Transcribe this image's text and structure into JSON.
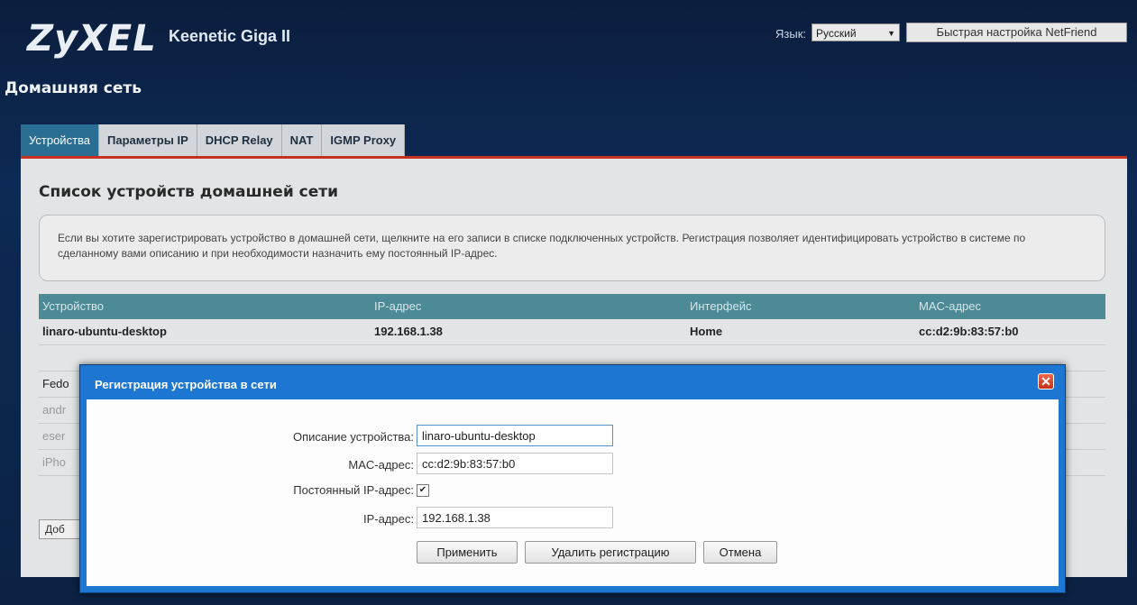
{
  "header": {
    "brand": "ZyXEL",
    "model": "Keenetic Giga II",
    "language_label": "Язык:",
    "language_value": "Русский",
    "quick_setup_label": "Быстрая настройка NetFriend"
  },
  "page_title": "Домашняя сеть",
  "tabs": [
    {
      "label": "Устройства",
      "active": true
    },
    {
      "label": "Параметры IP",
      "active": false
    },
    {
      "label": "DHCP Relay",
      "active": false
    },
    {
      "label": "NAT",
      "active": false
    },
    {
      "label": "IGMP Proxy",
      "active": false
    }
  ],
  "main": {
    "section_title": "Список устройств домашней сети",
    "info_text": "Если вы хотите зарегистрировать устройство в домашней сети, щелкните на его записи в списке подключенных устройств. Регистрация позволяет идентифицировать устройство в системе по сделанному вами описанию и при необходимости назначить ему постоянный IP-адрес.",
    "table": {
      "columns": [
        "Устройство",
        "IP-адрес",
        "Интерфейс",
        "MAC-адрес"
      ],
      "rows": [
        [
          "linaro-ubuntu-desktop",
          "192.168.1.38",
          "Home",
          "cc:d2:9b:83:57:b0"
        ],
        [
          "",
          "",
          "",
          ""
        ],
        [
          "Fedo",
          "",
          "",
          ""
        ],
        [
          "andr",
          "",
          "",
          ""
        ],
        [
          "eser",
          "",
          "",
          ""
        ],
        [
          "iPho",
          "",
          "",
          ""
        ]
      ]
    },
    "add_button_label": "Доб"
  },
  "modal": {
    "title": "Регистрация устройства в сети",
    "fields": {
      "description_label": "Описание устройства:",
      "description_value": "linaro-ubuntu-desktop",
      "mac_label": "MAC-адрес:",
      "mac_value": "cc:d2:9b:83:57:b0",
      "static_ip_label": "Постоянный IP-адрес:",
      "static_ip_checked": true,
      "ip_label": "IP-адрес:",
      "ip_value": "192.168.1.38"
    },
    "buttons": {
      "apply": "Применить",
      "delete": "Удалить регистрацию",
      "cancel": "Отмена"
    }
  },
  "colors": {
    "accent_red": "#c83020",
    "modal_blue": "#1d76d1",
    "table_header": "#4c8a96",
    "active_tab": "#2a6f93"
  }
}
